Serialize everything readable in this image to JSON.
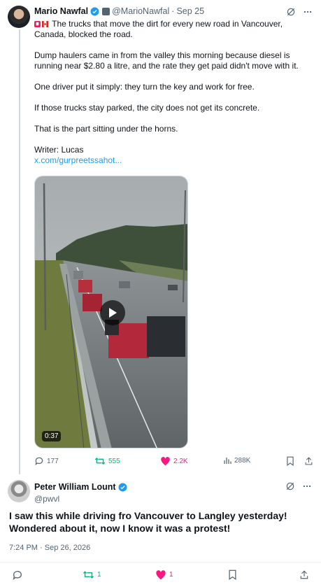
{
  "post1": {
    "author_name": "Mario Nawfal",
    "handle": "@MarioNawfal",
    "separator": "·",
    "date": "Sep 25",
    "paragraphs": [
      "The trucks that move the dirt for every new road in Vancouver, Canada, blocked the road.",
      "Dump haulers came in from the valley this morning because diesel is running near $2.80 a litre, and the rate they get paid didn't move with it.",
      "One driver put it simply: they turn the key and work for free.",
      "If those trucks stay parked, the city does not get its concrete.",
      "That is the part sitting under the horns.",
      "Writer: Lucas"
    ],
    "link": "x.com/gurpreetssahot...",
    "video_duration": "0:37",
    "stats": {
      "replies": "177",
      "reposts": "555",
      "likes": "2.2K",
      "views": "288K"
    }
  },
  "post2": {
    "author_name": "Peter William Lount",
    "handle": "@pwvl",
    "text": "I saw this while driving fro Vancouver to Langley yesterday! Wondered about it, now I know it was a protest!",
    "timestamp": "7:24 PM · Sep 26, 2026",
    "stats": {
      "reposts": "1",
      "likes": "1"
    }
  },
  "colors": {
    "accent": "#1d9bf0",
    "repost": "#00ba7c",
    "like": "#f91880",
    "muted": "#536471"
  }
}
